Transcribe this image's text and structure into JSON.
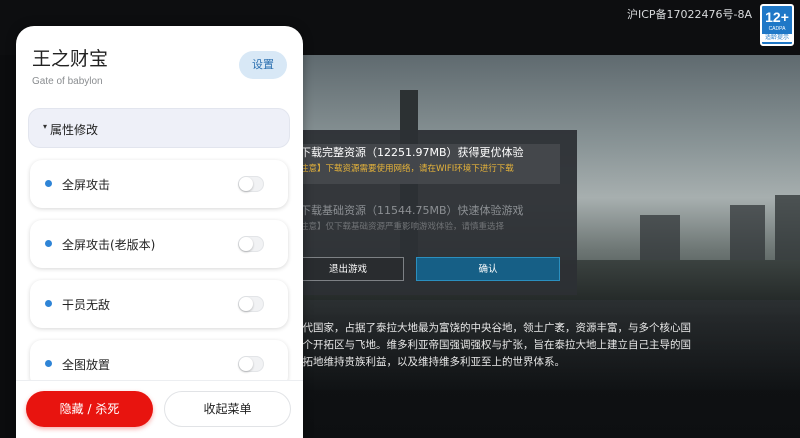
{
  "game": {
    "icp_text": "沪ICP备17022476号-8A",
    "age_rating": {
      "number": "12+",
      "org": "CADPA",
      "tip": "适龄提示"
    },
    "story_lines": [
      "现代国家，占据了泰拉大地最为富饶的中央谷地，领土广袤，资源丰富，与多个核心国",
      "数个开拓区与飞地。维多利亚帝国强调强权与扩张，旨在泰拉大地上建立自己主导的国",
      "开拓地维持贵族利益，以及维持维多利亚至上的世界体系。"
    ],
    "download_dialog": {
      "option_full": {
        "title": "下载完整资源（12251.97MB）获得更优体验",
        "note": "注意】下载资源需要使用网络，请在WIFI环境下进行下载"
      },
      "option_basic": {
        "title": "下载基础资源（11544.75MB）快速体验游戏",
        "note": "注意】仅下载基础资源严重影响游戏体验，请慎重选择"
      },
      "exit_label": "退出游戏",
      "confirm_label": "确认"
    }
  },
  "panel": {
    "title": "王之财宝",
    "subtitle": "Gate of babylon",
    "settings_label": "设置",
    "section": {
      "caret": "▾",
      "label": "属性修改"
    },
    "items": [
      {
        "label": "全屏攻击",
        "enabled": false
      },
      {
        "label": "全屏攻击(老版本)",
        "enabled": false
      },
      {
        "label": "干员无敌",
        "enabled": false
      },
      {
        "label": "全图放置",
        "enabled": false
      }
    ],
    "hide_kill_label": "隐藏 / 杀死",
    "collapse_label": "收起菜单"
  },
  "colors": {
    "accent_blue": "#2f84d6",
    "danger_red": "#e8140f",
    "warning_yellow": "#e7b43a",
    "confirm_blue": "#165f86"
  }
}
